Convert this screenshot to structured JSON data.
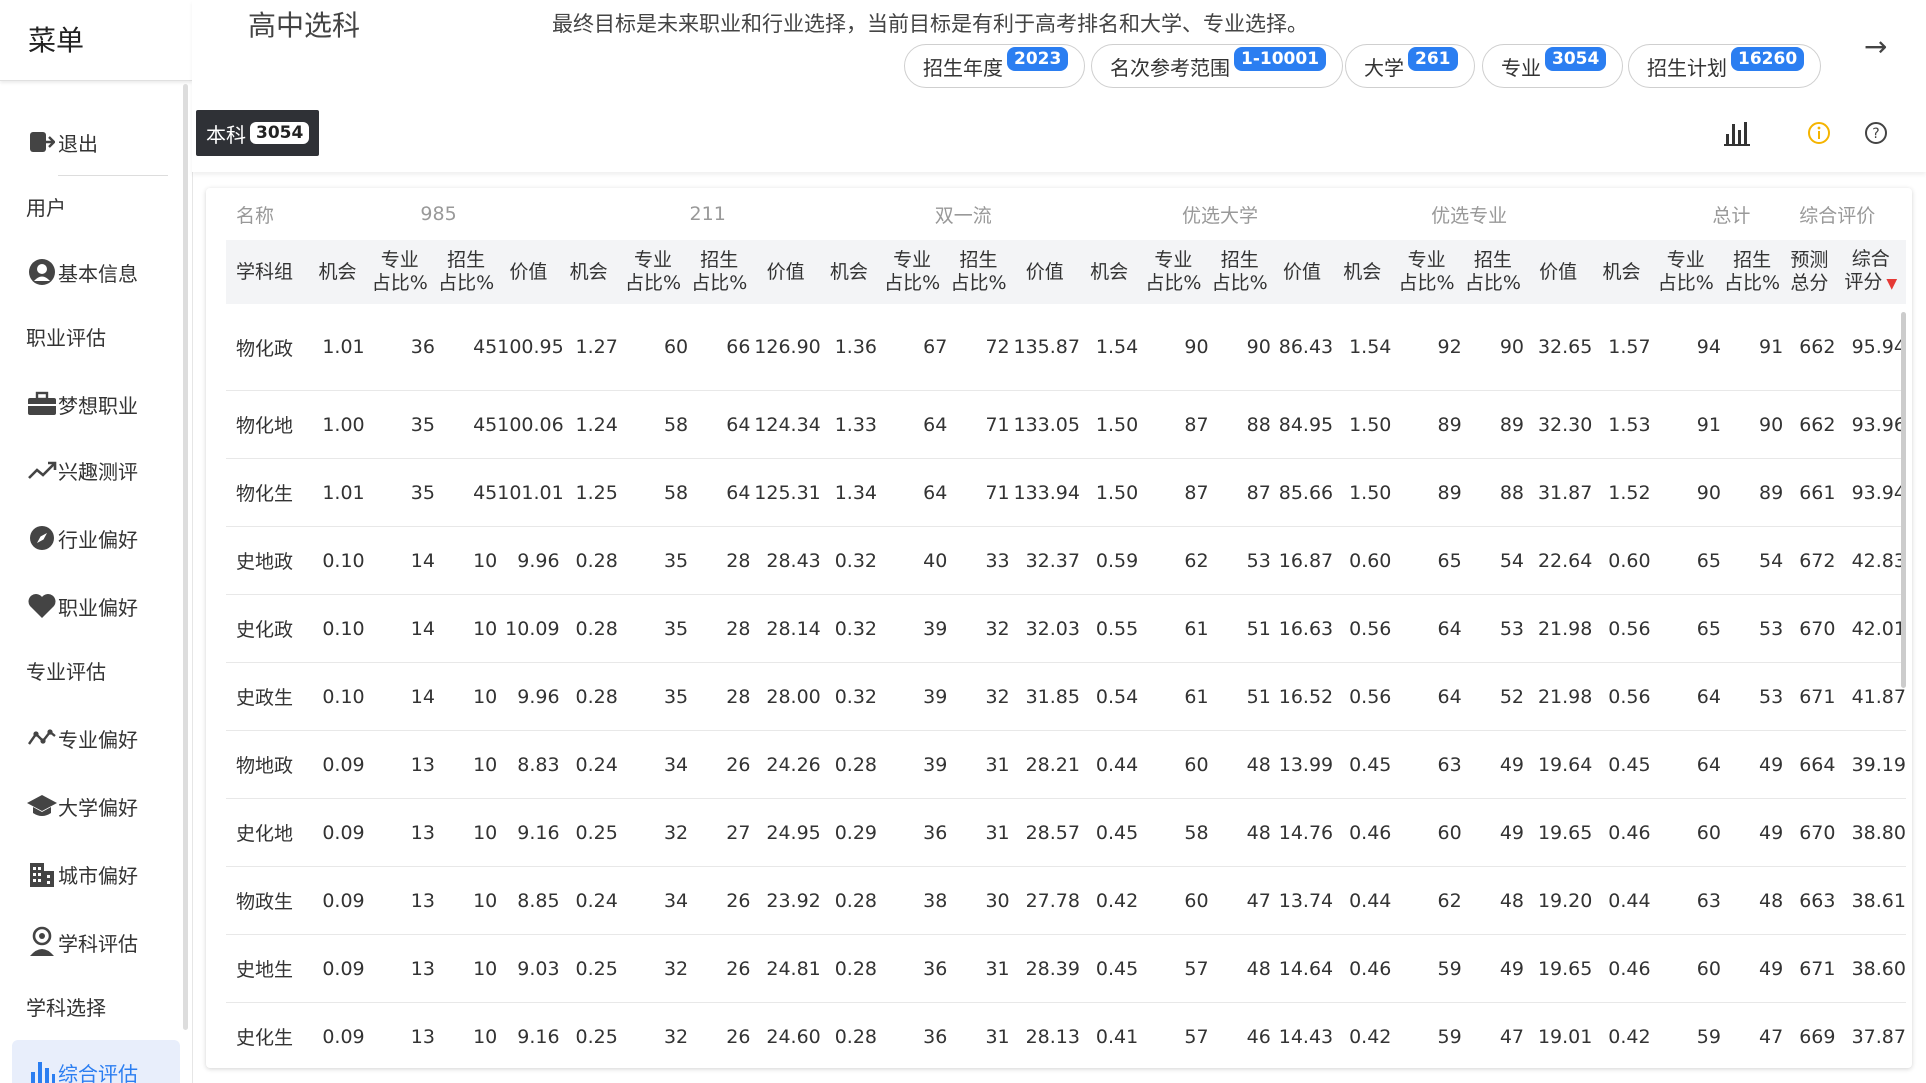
{
  "sidebar": {
    "title": "菜单",
    "items": [
      {
        "label": "退出",
        "icon": "logout-icon",
        "type": "item"
      },
      {
        "label": "用户",
        "type": "section"
      },
      {
        "label": "基本信息",
        "icon": "account-icon",
        "type": "item"
      },
      {
        "label": "职业评估",
        "type": "section"
      },
      {
        "label": "梦想职业",
        "icon": "briefcase-icon",
        "type": "item"
      },
      {
        "label": "兴趣测评",
        "icon": "trend-icon",
        "type": "item"
      },
      {
        "label": "行业偏好",
        "icon": "compass-icon",
        "type": "item"
      },
      {
        "label": "职业偏好",
        "icon": "heart-icon",
        "type": "item"
      },
      {
        "label": "专业评估",
        "type": "section"
      },
      {
        "label": "专业偏好",
        "icon": "timeline-icon",
        "type": "item"
      },
      {
        "label": "大学偏好",
        "icon": "graduation-cap-icon",
        "type": "item"
      },
      {
        "label": "城市偏好",
        "icon": "city-icon",
        "type": "item"
      },
      {
        "label": "学科评估",
        "icon": "person-badge-icon",
        "type": "item"
      },
      {
        "label": "学科选择",
        "type": "section"
      },
      {
        "label": "综合评估",
        "icon": "bar-chart-icon",
        "type": "item",
        "active": true
      }
    ]
  },
  "header": {
    "title": "高中选科",
    "goal": "最终目标是未来职业和行业选择，当前目标是有利于高考排名和大学、专业选择。",
    "chips": [
      {
        "label": "招生年度",
        "value": "2023"
      },
      {
        "label": "名次参考范围",
        "value": "1-10001"
      },
      {
        "label": "大学",
        "value": "261"
      },
      {
        "label": "专业",
        "value": "3054"
      },
      {
        "label": "招生计划",
        "value": "16260"
      }
    ],
    "tab": {
      "label": "本科",
      "count": "3054"
    },
    "icons": [
      "bar-chart-icon",
      "info-icon",
      "help-icon"
    ],
    "accent": "#2b7ef1"
  },
  "table": {
    "groups": [
      "名称",
      "985",
      "211",
      "双一流",
      "优选大学",
      "优选专业",
      "总计",
      "综合评价"
    ],
    "subheaders": {
      "name": "学科组",
      "chance": "机会",
      "major_pct": [
        "专业",
        "占比%"
      ],
      "admit_pct": [
        "招生",
        "占比%"
      ],
      "value": "价值",
      "predict": [
        "预测",
        "总分"
      ],
      "overall": [
        "综合",
        "评分"
      ]
    },
    "rows": [
      [
        "物化政",
        "1.01",
        "36",
        "45",
        "100.95",
        "1.27",
        "60",
        "66",
        "126.90",
        "1.36",
        "67",
        "72",
        "135.87",
        "1.54",
        "90",
        "90",
        "86.43",
        "1.54",
        "92",
        "90",
        "32.65",
        "1.57",
        "94",
        "91",
        "662",
        "95.94"
      ],
      [
        "物化地",
        "1.00",
        "35",
        "45",
        "100.06",
        "1.24",
        "58",
        "64",
        "124.34",
        "1.33",
        "64",
        "71",
        "133.05",
        "1.50",
        "87",
        "88",
        "84.95",
        "1.50",
        "89",
        "89",
        "32.30",
        "1.53",
        "91",
        "90",
        "662",
        "93.96"
      ],
      [
        "物化生",
        "1.01",
        "35",
        "45",
        "101.01",
        "1.25",
        "58",
        "64",
        "125.31",
        "1.34",
        "64",
        "71",
        "133.94",
        "1.50",
        "87",
        "87",
        "85.66",
        "1.50",
        "89",
        "88",
        "31.87",
        "1.52",
        "90",
        "89",
        "661",
        "93.94"
      ],
      [
        "史地政",
        "0.10",
        "14",
        "10",
        "9.96",
        "0.28",
        "35",
        "28",
        "28.43",
        "0.32",
        "40",
        "33",
        "32.37",
        "0.59",
        "62",
        "53",
        "16.87",
        "0.60",
        "65",
        "54",
        "22.64",
        "0.60",
        "65",
        "54",
        "672",
        "42.83"
      ],
      [
        "史化政",
        "0.10",
        "14",
        "10",
        "10.09",
        "0.28",
        "35",
        "28",
        "28.14",
        "0.32",
        "39",
        "32",
        "32.03",
        "0.55",
        "61",
        "51",
        "16.63",
        "0.56",
        "64",
        "53",
        "21.98",
        "0.56",
        "65",
        "53",
        "670",
        "42.01"
      ],
      [
        "史政生",
        "0.10",
        "14",
        "10",
        "9.96",
        "0.28",
        "35",
        "28",
        "28.00",
        "0.32",
        "39",
        "32",
        "31.85",
        "0.54",
        "61",
        "51",
        "16.52",
        "0.56",
        "64",
        "52",
        "21.98",
        "0.56",
        "64",
        "53",
        "671",
        "41.87"
      ],
      [
        "物地政",
        "0.09",
        "13",
        "10",
        "8.83",
        "0.24",
        "34",
        "26",
        "24.26",
        "0.28",
        "39",
        "31",
        "28.21",
        "0.44",
        "60",
        "48",
        "13.99",
        "0.45",
        "63",
        "49",
        "19.64",
        "0.45",
        "64",
        "49",
        "664",
        "39.19"
      ],
      [
        "史化地",
        "0.09",
        "13",
        "10",
        "9.16",
        "0.25",
        "32",
        "27",
        "24.95",
        "0.29",
        "36",
        "31",
        "28.57",
        "0.45",
        "58",
        "48",
        "14.76",
        "0.46",
        "60",
        "49",
        "19.65",
        "0.46",
        "60",
        "49",
        "670",
        "38.80"
      ],
      [
        "物政生",
        "0.09",
        "13",
        "10",
        "8.85",
        "0.24",
        "34",
        "26",
        "23.92",
        "0.28",
        "38",
        "30",
        "27.78",
        "0.42",
        "60",
        "47",
        "13.74",
        "0.44",
        "62",
        "48",
        "19.20",
        "0.44",
        "63",
        "48",
        "663",
        "38.61"
      ],
      [
        "史地生",
        "0.09",
        "13",
        "10",
        "9.03",
        "0.25",
        "32",
        "26",
        "24.81",
        "0.28",
        "36",
        "31",
        "28.39",
        "0.45",
        "57",
        "48",
        "14.64",
        "0.46",
        "59",
        "49",
        "19.65",
        "0.46",
        "60",
        "49",
        "671",
        "38.60"
      ],
      [
        "史化生",
        "0.09",
        "13",
        "10",
        "9.16",
        "0.25",
        "32",
        "26",
        "24.60",
        "0.28",
        "36",
        "31",
        "28.13",
        "0.41",
        "57",
        "46",
        "14.43",
        "0.42",
        "59",
        "47",
        "19.01",
        "0.42",
        "59",
        "47",
        "669",
        "37.87"
      ]
    ]
  }
}
